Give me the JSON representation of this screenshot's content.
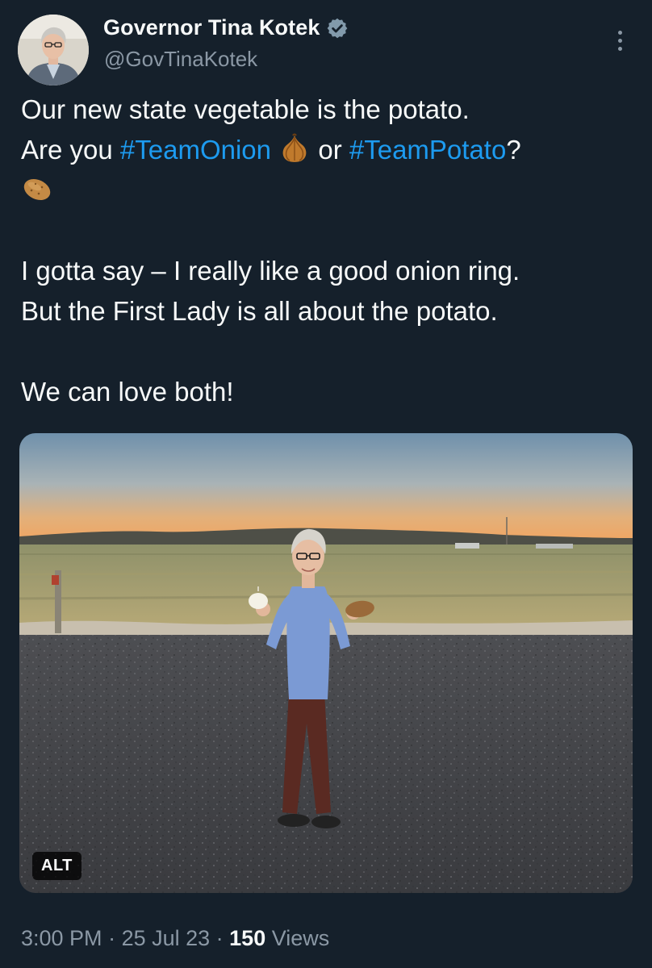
{
  "author": {
    "display_name": "Governor Tina Kotek",
    "handle": "@GovTinaKotek",
    "verified": true
  },
  "tweet": {
    "line1": "Our new state vegetable is the potato.",
    "line2_prefix": "Are you ",
    "hashtag_onion": "#TeamOnion",
    "emoji_onion": "onion-emoji",
    "line2_middle": " or ",
    "hashtag_potato": "#TeamPotato",
    "line2_suffix": "?",
    "emoji_potato": "potato-emoji",
    "para2_line1": "I gotta say – I really like a good onion ring.",
    "para2_line2": "But the First Lady is all about the potato.",
    "para3": "We can love both!"
  },
  "media": {
    "alt_label": "ALT"
  },
  "meta": {
    "time": "3:00 PM",
    "separator1": " · ",
    "date": "25 Jul 23",
    "separator2": " · ",
    "views_count": "150",
    "views_label": " Views"
  },
  "colors": {
    "background": "#15202b",
    "text": "#f7f9f9",
    "secondary": "#8b98a5",
    "link": "#1d9bf0"
  }
}
